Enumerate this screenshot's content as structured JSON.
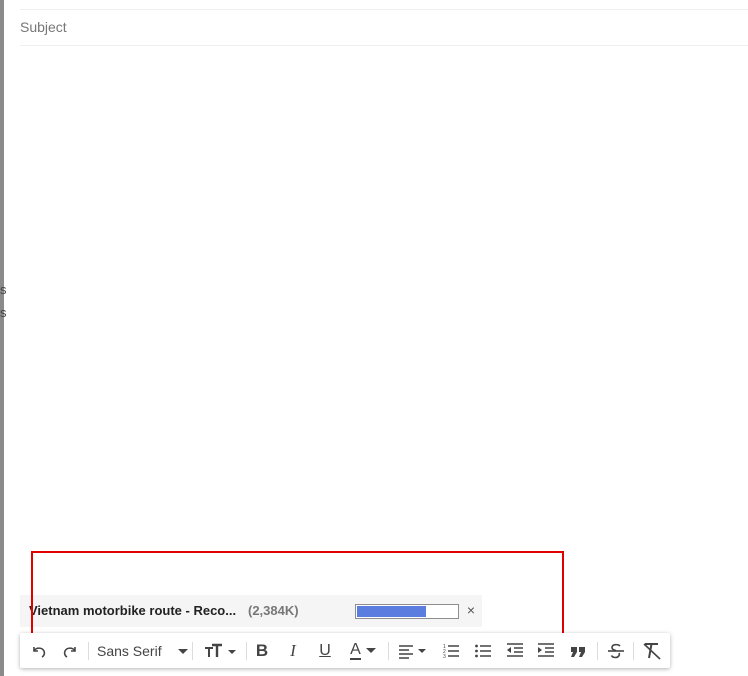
{
  "compose": {
    "subject_placeholder": "Subject",
    "subject_value": ""
  },
  "left_edge": {
    "glyph_1": "s",
    "glyph_2": "s"
  },
  "attachment": {
    "name": "Vietnam motorbike route - Reco...",
    "size": "(2,384K)",
    "progress_percent": 70,
    "remove_icon": "×"
  },
  "toolbar": {
    "font_name": "Sans Serif",
    "bold": "B",
    "italic": "I",
    "underline": "U",
    "text_color": "A",
    "icons": [
      "undo-icon",
      "redo-icon",
      "font-size-icon",
      "bold-icon",
      "italic-icon",
      "underline-icon",
      "text-color-icon",
      "align-icon",
      "numbered-list-icon",
      "bulleted-list-icon",
      "indent-less-icon",
      "indent-more-icon",
      "quote-icon",
      "strikethrough-icon",
      "remove-formatting-icon"
    ]
  },
  "colors": {
    "progress_fill": "#5b7de0",
    "highlight_box": "#e00000",
    "attachment_bg": "#f5f5f5"
  }
}
